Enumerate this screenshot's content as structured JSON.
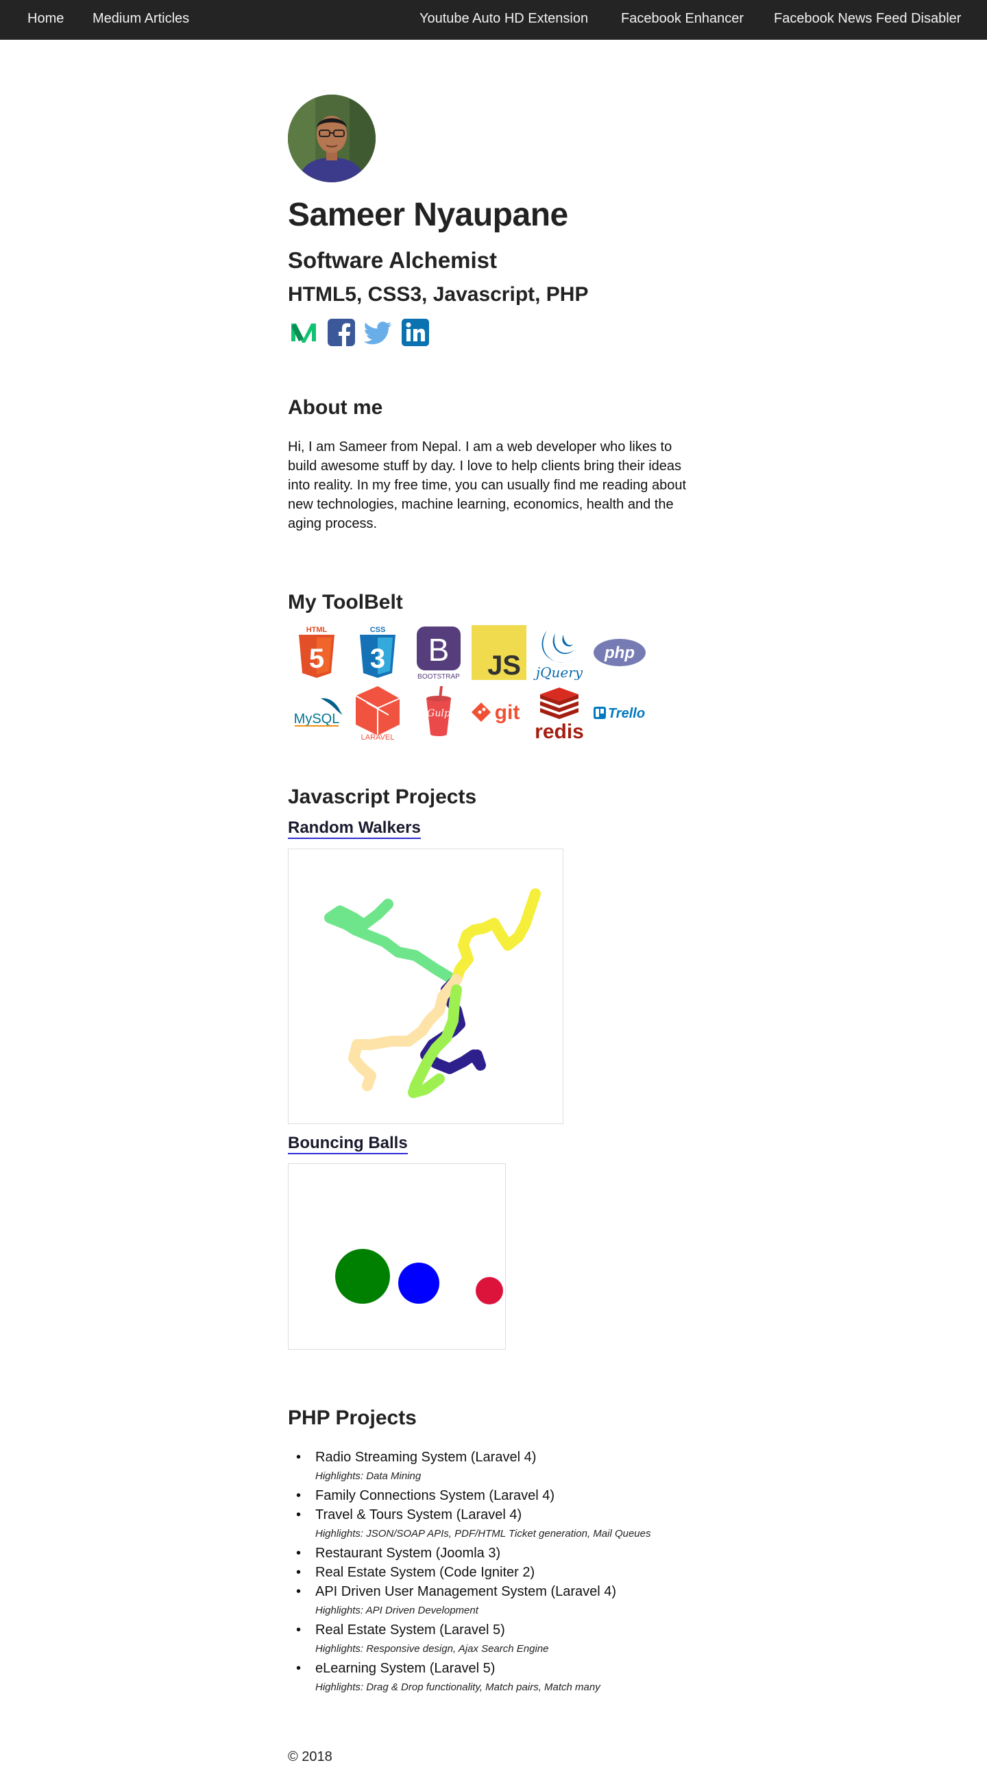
{
  "nav": {
    "left": [
      "Home",
      "Medium Articles"
    ],
    "right": [
      "Youtube Auto HD Extension",
      "Facebook Enhancer",
      "Facebook News Feed Disabler"
    ]
  },
  "profile": {
    "name": "Sameer Nyaupane",
    "role": "Software Alchemist",
    "stack": "HTML5, CSS3, Javascript, PHP"
  },
  "social": [
    "medium-icon",
    "facebook-icon",
    "twitter-icon",
    "linkedin-icon"
  ],
  "about": {
    "title": "About me",
    "text": "Hi, I am Sameer from Nepal. I am a web developer who likes to build awesome stuff by day. I love to help clients bring their ideas into reality. In my free time, you can usually find me reading about new technologies, machine learning, economics, health and the aging process."
  },
  "toolbelt": {
    "title": "My ToolBelt",
    "tools": [
      {
        "name": "html5",
        "label": "HTML",
        "badge": "5"
      },
      {
        "name": "css3",
        "label": "CSS",
        "badge": "3"
      },
      {
        "name": "bootstrap",
        "letter": "B",
        "label": "BOOTSTRAP"
      },
      {
        "name": "javascript",
        "label": "JS"
      },
      {
        "name": "jquery",
        "label": "jQuery"
      },
      {
        "name": "php",
        "label": "php"
      },
      {
        "name": "mysql",
        "label": "MySQL"
      },
      {
        "name": "laravel",
        "label": "LARAVEL"
      },
      {
        "name": "gulp",
        "label": "Gulp"
      },
      {
        "name": "git",
        "label": "git"
      },
      {
        "name": "redis",
        "label": "redis"
      },
      {
        "name": "trello",
        "label": "Trello"
      }
    ]
  },
  "js_projects": {
    "title": "Javascript Projects",
    "items": [
      {
        "label": "Random Walkers",
        "walker_colors": [
          "#6ee58a",
          "#f5ee3a",
          "#2d1f8c",
          "#fde3a7",
          "#9ef050"
        ]
      },
      {
        "label": "Bouncing Balls",
        "ball_colors": [
          "#008000",
          "#0000ff",
          "#dc143c"
        ]
      }
    ]
  },
  "php_projects": {
    "title": "PHP Projects",
    "items": [
      {
        "label": "Radio Streaming System (Laravel 4)",
        "highlights": "Highlights: Data Mining"
      },
      {
        "label": "Family Connections System (Laravel 4)",
        "highlights": ""
      },
      {
        "label": "Travel & Tours System (Laravel 4)",
        "highlights": "Highlights: JSON/SOAP APIs, PDF/HTML Ticket generation, Mail Queues"
      },
      {
        "label": "Restaurant System (Joomla 3)",
        "highlights": ""
      },
      {
        "label": "Real Estate System (Code Igniter 2)",
        "highlights": ""
      },
      {
        "label": "API Driven User Management System (Laravel 4)",
        "highlights": "Highlights: API Driven Development"
      },
      {
        "label": "Real Estate System (Laravel 5)",
        "highlights": "Highlights: Responsive design, Ajax Search Engine"
      },
      {
        "label": "eLearning System (Laravel 5)",
        "highlights": "Highlights: Drag & Drop functionality, Match pairs, Match many"
      }
    ]
  },
  "footer": "© 2018"
}
